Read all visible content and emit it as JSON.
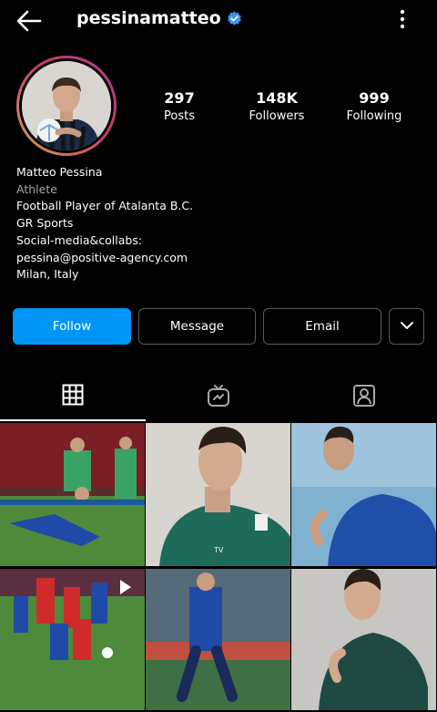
{
  "header": {
    "username": "pessinamatteo",
    "back_icon": "arrow-left-icon",
    "verified_icon": "verified-badge-icon",
    "more_icon": "vertical-ellipsis-icon"
  },
  "stats": {
    "posts": {
      "value": "297",
      "label": "Posts"
    },
    "followers": {
      "value": "148K",
      "label": "Followers"
    },
    "following": {
      "value": "999",
      "label": "Following"
    }
  },
  "bio": {
    "name": "Matteo Pessina",
    "category": "Athlete",
    "lines": [
      "Football Player of Atalanta B.C.",
      "GR Sports",
      "Social-media&collabs:",
      "pessina@positive-agency.com",
      "Milan, Italy"
    ]
  },
  "actions": {
    "follow": "Follow",
    "message": "Message",
    "email": "Email",
    "suggest_icon": "chevron-down-icon"
  },
  "tabs": [
    {
      "icon": "grid-icon",
      "active": true
    },
    {
      "icon": "igtv-icon",
      "active": false
    },
    {
      "icon": "tagged-user-icon",
      "active": false
    }
  ],
  "colors": {
    "background": "#000000",
    "accent_blue": "#0095f6",
    "muted_text": "#a8a8a8",
    "button_border": "#5a5a5a"
  }
}
